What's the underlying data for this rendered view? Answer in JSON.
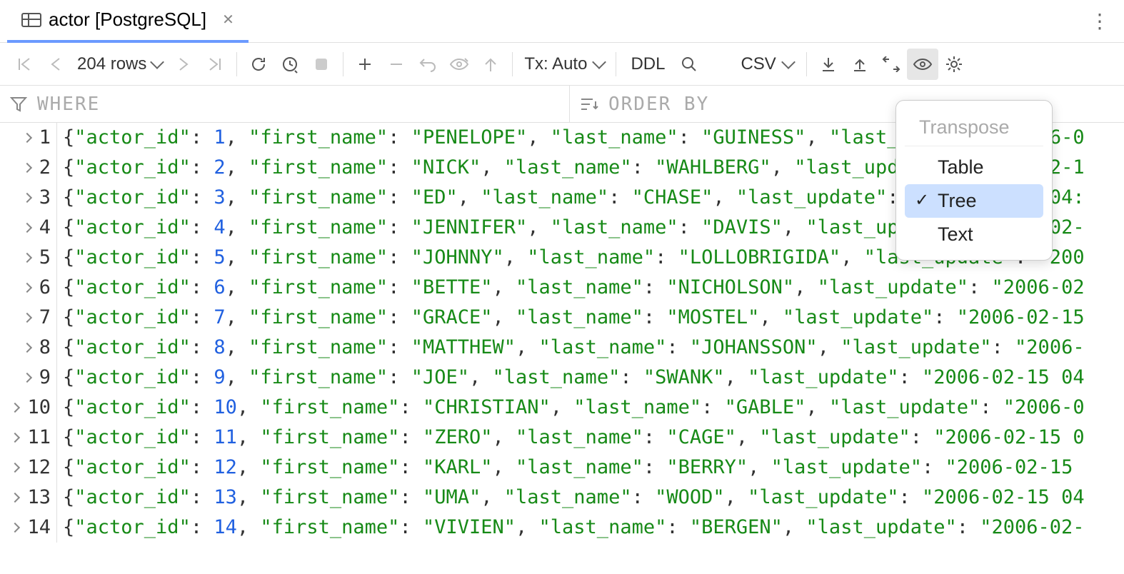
{
  "tab": {
    "title": "actor [PostgreSQL]"
  },
  "toolbar": {
    "rows_label": "204 rows",
    "tx_label": "Tx: Auto",
    "ddl_label": "DDL",
    "csv_label": "CSV"
  },
  "filter": {
    "where_placeholder": "WHERE",
    "orderby_placeholder": "ORDER BY"
  },
  "popup": {
    "header": "Transpose",
    "items": [
      "Table",
      "Tree",
      "Text"
    ],
    "selected": "Tree"
  },
  "rows": [
    {
      "n": 1,
      "actor_id": 1,
      "first_name": "PENELOPE",
      "last_name": "GUINESS",
      "last_update": "2006-0"
    },
    {
      "n": 2,
      "actor_id": 2,
      "first_name": "NICK",
      "last_name": "WAHLBERG",
      "last_update": "2006-02-1"
    },
    {
      "n": 3,
      "actor_id": 3,
      "first_name": "ED",
      "last_name": "CHASE",
      "last_update": "2006-02-15 04:"
    },
    {
      "n": 4,
      "actor_id": 4,
      "first_name": "JENNIFER",
      "last_name": "DAVIS",
      "last_update": "2006-02-"
    },
    {
      "n": 5,
      "actor_id": 5,
      "first_name": "JOHNNY",
      "last_name": "LOLLOBRIGIDA",
      "last_update": "200"
    },
    {
      "n": 6,
      "actor_id": 6,
      "first_name": "BETTE",
      "last_name": "NICHOLSON",
      "last_update": "2006-02"
    },
    {
      "n": 7,
      "actor_id": 7,
      "first_name": "GRACE",
      "last_name": "MOSTEL",
      "last_update": "2006-02-15"
    },
    {
      "n": 8,
      "actor_id": 8,
      "first_name": "MATTHEW",
      "last_name": "JOHANSSON",
      "last_update": "2006-"
    },
    {
      "n": 9,
      "actor_id": 9,
      "first_name": "JOE",
      "last_name": "SWANK",
      "last_update": "2006-02-15 04"
    },
    {
      "n": 10,
      "actor_id": 10,
      "first_name": "CHRISTIAN",
      "last_name": "GABLE",
      "last_update": "2006-0"
    },
    {
      "n": 11,
      "actor_id": 11,
      "first_name": "ZERO",
      "last_name": "CAGE",
      "last_update": "2006-02-15 0"
    },
    {
      "n": 12,
      "actor_id": 12,
      "first_name": "KARL",
      "last_name": "BERRY",
      "last_update": "2006-02-15 "
    },
    {
      "n": 13,
      "actor_id": 13,
      "first_name": "UMA",
      "last_name": "WOOD",
      "last_update": "2006-02-15 04"
    },
    {
      "n": 14,
      "actor_id": 14,
      "first_name": "VIVIEN",
      "last_name": "BERGEN",
      "last_update": "2006-02-"
    }
  ],
  "keys": {
    "actor_id": "\"actor_id\"",
    "first_name": "\"first_name\"",
    "last_name": "\"last_name\"",
    "last_update": "\"last_update\""
  }
}
